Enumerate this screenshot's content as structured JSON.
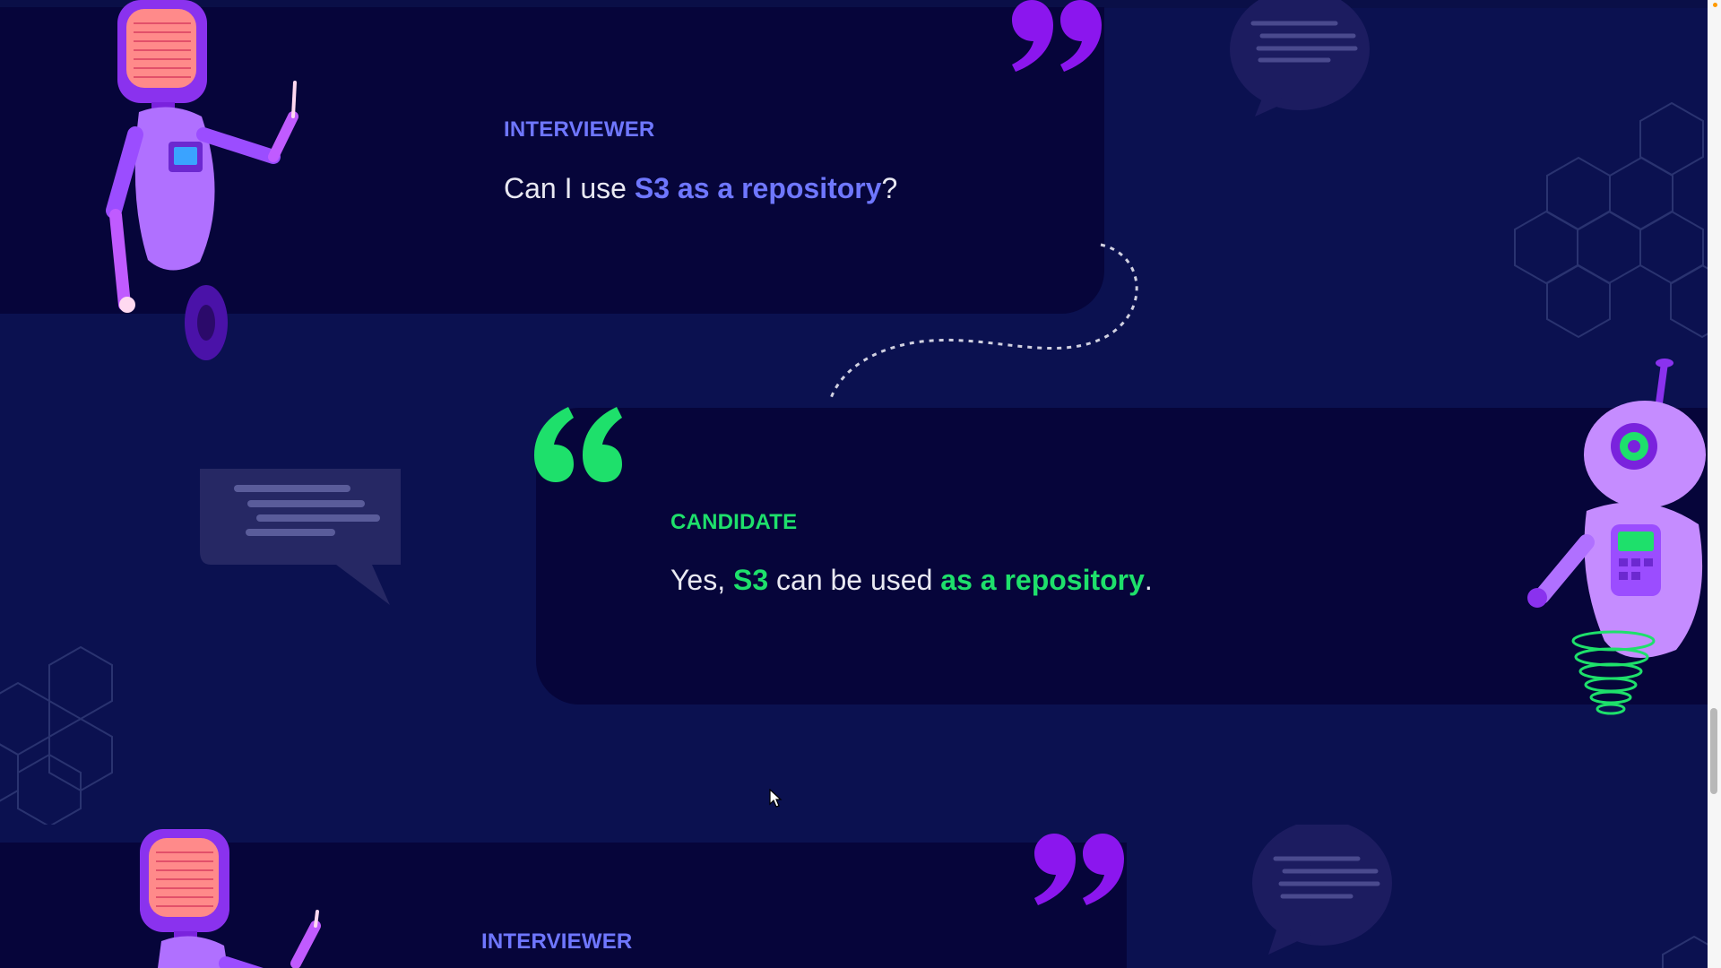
{
  "dialog": [
    {
      "speaker": "INTERVIEWER",
      "text_pre": "Can I use ",
      "highlight": "S3 as a repository",
      "text_post": "?"
    },
    {
      "speaker": "CANDIDATE",
      "text_pre": "Yes, ",
      "highlight_1": "S3",
      "text_mid": " can be used ",
      "highlight_2": "as a repository",
      "text_post": "."
    },
    {
      "speaker": "INTERVIEWER"
    }
  ],
  "colors": {
    "background": "#0b1150",
    "card": "#06053a",
    "interviewer_accent": "#6f77ff",
    "candidate_accent": "#1ee06b",
    "quote_purple": "#8b16ee",
    "robot_purple": "#9b4dff"
  },
  "icons": [
    "close-quote-icon",
    "open-quote-icon",
    "chat-bubble-icon",
    "hexagon-pattern",
    "robot-illustration",
    "mouse-cursor-icon"
  ]
}
